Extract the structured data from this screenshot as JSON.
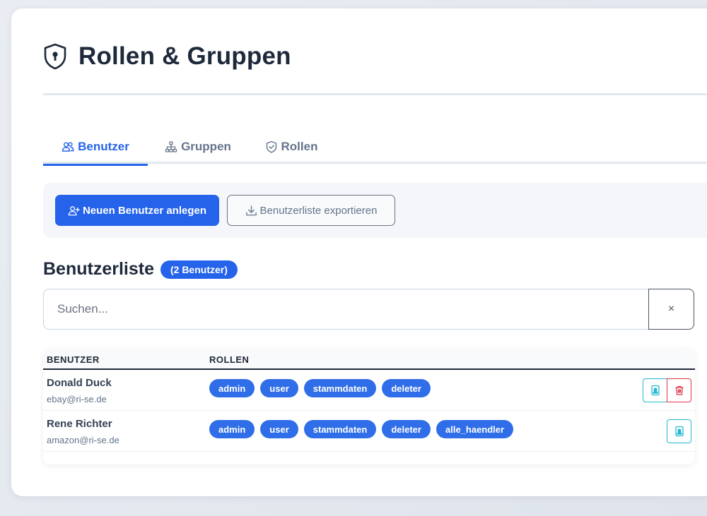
{
  "page": {
    "title": "Rollen & Gruppen",
    "title_icon": "shield-lock-icon"
  },
  "tabs": [
    {
      "label": "Benutzer",
      "icon": "users-icon",
      "active": true
    },
    {
      "label": "Gruppen",
      "icon": "sitemap-icon",
      "active": false
    },
    {
      "label": "Rollen",
      "icon": "shield-check-icon",
      "active": false
    }
  ],
  "toolbar": {
    "new_user_label": "Neuen Benutzer anlegen",
    "export_label": "Benutzerliste exportieren"
  },
  "user_list": {
    "title": "Benutzerliste",
    "count_badge": "(2 Benutzer)",
    "search_placeholder": "Suchen...",
    "clear_label": "×",
    "columns": [
      "BENUTZER",
      "ROLLEN"
    ],
    "rows": [
      {
        "name": "Donald Duck",
        "email": "ebay@ri-se.de",
        "roles": [
          "admin",
          "user",
          "stammdaten",
          "deleter"
        ],
        "actions": [
          "edit",
          "delete"
        ]
      },
      {
        "name": "Rene Richter",
        "email": "amazon@ri-se.de",
        "roles": [
          "admin",
          "user",
          "stammdaten",
          "deleter",
          "alle_haendler"
        ],
        "actions": [
          "edit"
        ]
      }
    ]
  },
  "colors": {
    "primary": "#2563eb",
    "edit_outline": "#22b8d0",
    "delete_outline": "#dc3545",
    "role_pill": "#2f6ee8"
  }
}
